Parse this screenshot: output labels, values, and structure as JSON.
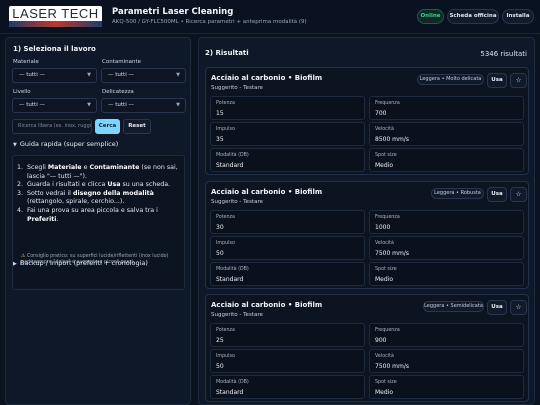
{
  "header": {
    "logo_text": "LASER TECH",
    "title": "Parametri Laser Cleaning",
    "subtitle": "AKQ-500 / GY-FLC500ML • Ricerca parametri + anteprima modalità (9)",
    "online_label": "Online",
    "scheda_label": "Scheda officina",
    "installa_label": "Installa"
  },
  "left": {
    "title": "1) Seleziona il lavoro",
    "materiale_label": "Materiale",
    "materiale_value": "— tutti —",
    "contaminante_label": "Contaminante",
    "contaminante_value": "— tutti —",
    "livello_label": "Livello",
    "livello_value": "— tutti —",
    "delicatezza_label": "Delicatezza",
    "delicatezza_value": "— tutti —",
    "search_placeholder": "Ricerca libera (es. inox, ruggine)",
    "cerca_label": "Cerca",
    "reset_label": "Reset",
    "guide_title": "Guida rapida (super semplice)",
    "steps": [
      {
        "pre": "Scegli ",
        "b1": "Materiale",
        "mid": " e ",
        "b2": "Contaminante",
        "post": " (se non sai, lascia \"— tutti —\")."
      },
      {
        "pre": "Guarda i risultati e clicca ",
        "b1": "Usa",
        "mid": "",
        "b2": "",
        "post": " su una scheda."
      },
      {
        "pre": "Sotto vedrai il ",
        "b1": "disegno della modalità",
        "mid": "",
        "b2": "",
        "post": " (rettangolo, spirale, cerchio...)."
      },
      {
        "pre": "Fai una prova su area piccola e salva tra i ",
        "b1": "Preferiti",
        "mid": "",
        "b2": "",
        "post": "."
      }
    ],
    "tip": "Consiglio pratico: su superfici lucide/riflettenti (inox lucido) parti sempre \"dolce\" e aumenta a piccoli passi.",
    "backup_title": "Backup / Import (preferiti + cronologia)"
  },
  "right": {
    "title": "2) Risultati",
    "count": "5346 risultati",
    "use_label": "Usa",
    "cards": [
      {
        "title": "Acciaio al carbonio • Biofilm",
        "subtitle": "Suggerito - Testare",
        "badge": "Leggera • Molto delicata",
        "potenza_k": "Potenza",
        "potenza_v": "15",
        "frequenza_k": "Frequenza",
        "frequenza_v": "700",
        "impulso_k": "Impulso",
        "impulso_v": "35",
        "velocita_k": "Velocità",
        "velocita_v": "8500 mm/s",
        "modalita_k": "Modalità (DB)",
        "modalita_v": "Standard",
        "spot_k": "Spot size",
        "spot_v": "Medio"
      },
      {
        "title": "Acciaio al carbonio • Biofilm",
        "subtitle": "Suggerito - Testare",
        "badge": "Leggera • Robusta",
        "potenza_k": "Potenza",
        "potenza_v": "30",
        "frequenza_k": "Frequenza",
        "frequenza_v": "1000",
        "impulso_k": "Impulso",
        "impulso_v": "50",
        "velocita_k": "Velocità",
        "velocita_v": "7500 mm/s",
        "modalita_k": "Modalità (DB)",
        "modalita_v": "Standard",
        "spot_k": "Spot size",
        "spot_v": "Medio"
      },
      {
        "title": "Acciaio al carbonio • Biofilm",
        "subtitle": "Suggerito - Testare",
        "badge": "Leggera • Semidelicata",
        "potenza_k": "Potenza",
        "potenza_v": "25",
        "frequenza_k": "Frequenza",
        "frequenza_v": "900",
        "impulso_k": "Impulso",
        "impulso_v": "50",
        "velocita_k": "Velocità",
        "velocita_v": "7500 mm/s",
        "modalita_k": "Modalità (DB)",
        "modalita_v": "Standard",
        "spot_k": "Spot size",
        "spot_v": "Medio"
      }
    ]
  },
  "icons": {
    "star": "star-icon",
    "warning": "warning-icon",
    "chevron": "chevron-down-icon",
    "disclosure": "triangle-disclosure-icon"
  },
  "colors": {
    "background": "#0b1220",
    "panel": "#0f1828",
    "accent": "#7fd3ff",
    "online": "#36d399",
    "warning": "#f2c14e"
  }
}
